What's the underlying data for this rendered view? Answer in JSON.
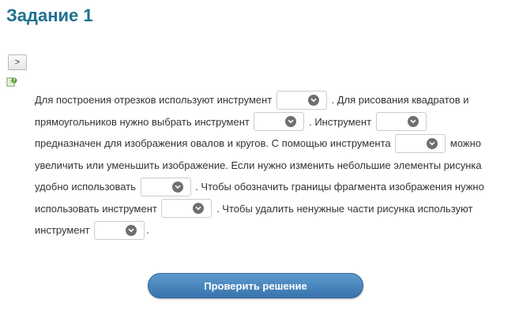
{
  "header": {
    "title": "Задание 1"
  },
  "toggle": {
    "label": ">"
  },
  "task": {
    "segments": [
      "Для построения отрезков используют инструмент",
      ". Для рисования квадратов и прямоугольников нужно выбрать инструмент",
      ". Инструмент",
      "предназначен для изображения овалов и кругов. С помощью инструмента",
      "можно увеличить или уменьшить изображение. Если нужно изменить небольшие элементы рисунка удобно использовать",
      ". Чтобы обозначить границы фрагмента изображения нужно использовать инструмент",
      ". Чтобы удалить ненужные части рисунка используют инструмент",
      "."
    ],
    "dropdowns": [
      {
        "selected": ""
      },
      {
        "selected": ""
      },
      {
        "selected": ""
      },
      {
        "selected": ""
      },
      {
        "selected": ""
      },
      {
        "selected": ""
      },
      {
        "selected": ""
      }
    ]
  },
  "icons": {
    "help": "help-question-icon",
    "dropdown": "chevron-down-icon"
  },
  "colors": {
    "title": "#1e7190",
    "button_top": "#5d9bce",
    "button_bottom": "#3873ad",
    "text": "#333333"
  },
  "actions": {
    "check_label": "Проверить решение"
  }
}
